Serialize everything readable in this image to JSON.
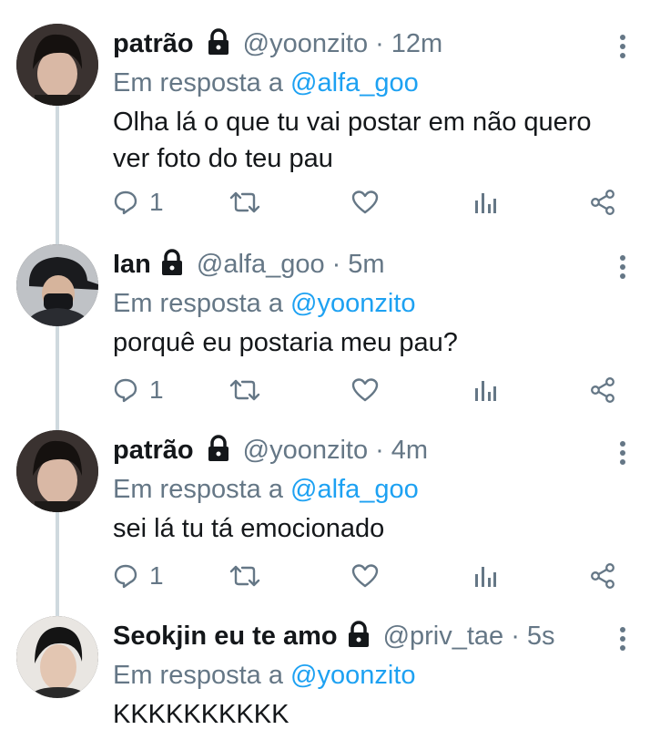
{
  "tweets": [
    {
      "name": "patrão",
      "handle": "@yoonzito",
      "time": "12m",
      "reply_prefix": "Em resposta a",
      "reply_to": "@alfa_goo",
      "text_lines": [
        "Olha lá o que tu vai postar em não quero",
        "ver foto do teu pau"
      ],
      "reply_count": "1"
    },
    {
      "name": "Ian",
      "handle": "@alfa_goo",
      "time": "5m",
      "reply_prefix": "Em resposta a",
      "reply_to": "@yoonzito",
      "text_lines": [
        "porquê eu postaria meu pau?"
      ],
      "reply_count": "1"
    },
    {
      "name": "patrão",
      "handle": "@yoonzito",
      "time": "4m",
      "reply_prefix": "Em resposta a",
      "reply_to": "@alfa_goo",
      "text_lines": [
        "sei lá tu tá emocionado"
      ],
      "reply_count": "1"
    },
    {
      "name": "Seokjin eu te amo",
      "handle": "@priv_tae",
      "time": "5s",
      "reply_prefix": "Em resposta a",
      "reply_to": "@yoonzito",
      "text_lines": [
        "KKKKKKKKKK"
      ]
    }
  ],
  "separator": "·",
  "icons": {
    "reply": "comment-icon",
    "retweet": "retweet-icon",
    "like": "heart-icon",
    "analytics": "analytics-icon",
    "share": "share-icon",
    "more": "more-vertical-icon",
    "lock": "lock-icon"
  },
  "colors": {
    "link": "#1da1f2",
    "secondary": "#657786",
    "text": "#14171a",
    "thread_line": "#cfd9de"
  }
}
